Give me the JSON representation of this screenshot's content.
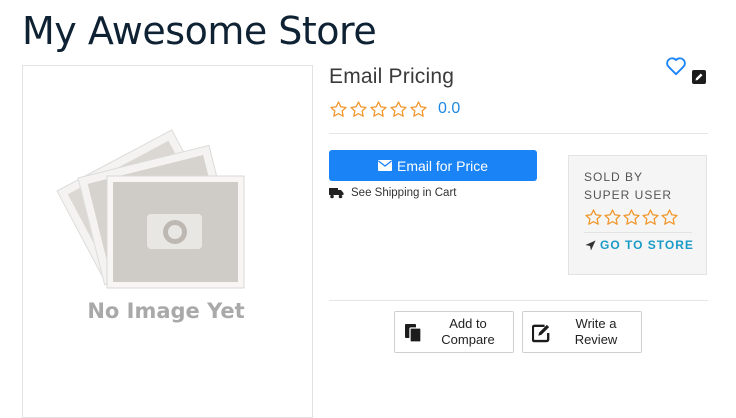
{
  "header": {
    "store_title": "My Awesome Store"
  },
  "product": {
    "name": "Email Pricing",
    "rating": 0,
    "rating_label": "0.0",
    "image_alt": "No Image Yet"
  },
  "pricing": {
    "email_button_label": "Email for Price"
  },
  "shipping": {
    "text": "See Shipping in Cart"
  },
  "seller": {
    "sold_by_label": "SOLD BY",
    "name": "SUPER USER",
    "rating": 0,
    "goto_label": "GO TO STORE"
  },
  "actions": {
    "compare_label": "Add to\nCompare",
    "review_label": "Write a\nReview"
  },
  "icons": {
    "wishlist": "heart-icon",
    "edit": "edit-icon",
    "email": "envelope-icon",
    "shipping": "truck-icon",
    "goto": "location-arrow-icon",
    "compare": "copy-icon",
    "review": "pencil-square-icon",
    "star": "star-outline-icon"
  },
  "colors": {
    "primary": "#1a83f5",
    "star": "#f0962b",
    "rating_value": "#1e88e5",
    "link": "#1a9bc7",
    "title": "#0f2233",
    "heart": "#1a83f5"
  }
}
